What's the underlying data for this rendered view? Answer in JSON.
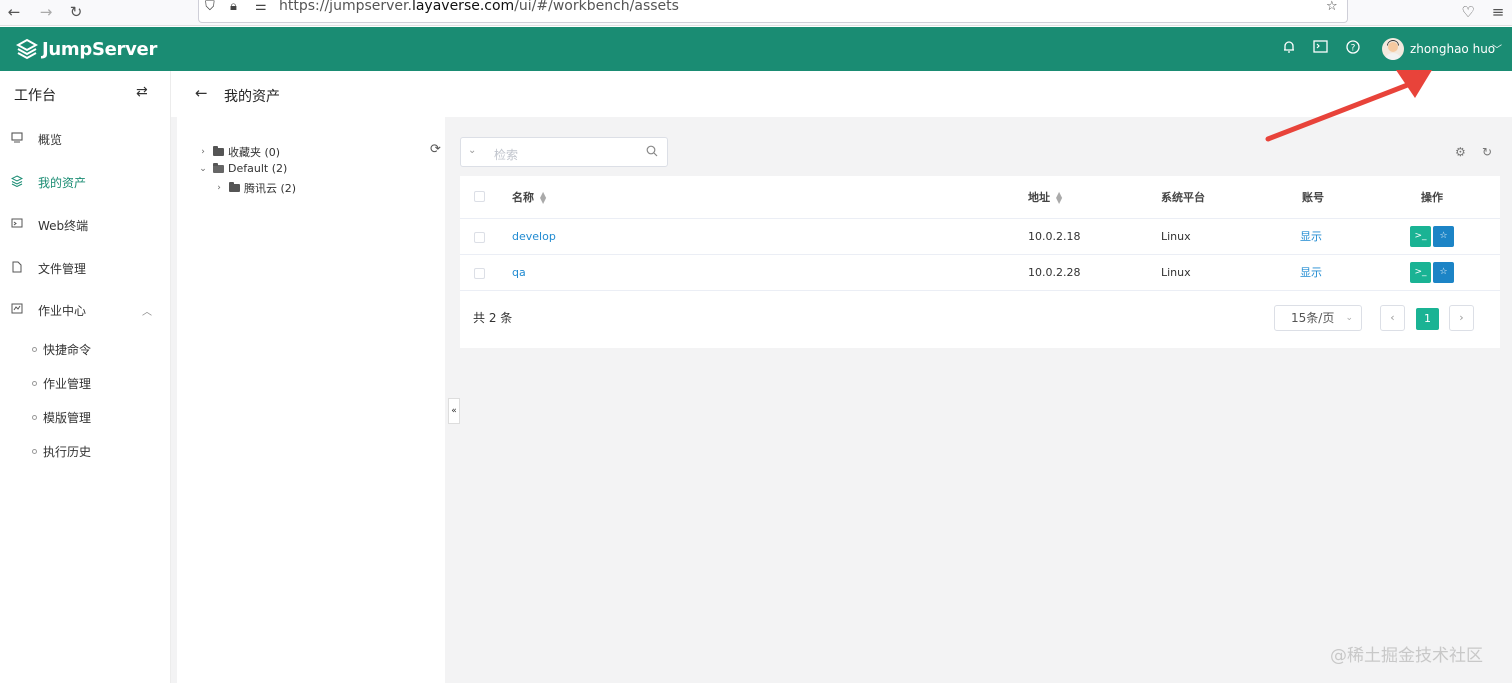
{
  "browser": {
    "url_prefix": "https://jumpserver.",
    "url_domain": "layaverse.com",
    "url_path": "/ui/#/workbench/assets"
  },
  "header": {
    "logo_text": "JumpServer",
    "user_name": "zhonghao huo",
    "brand_color": "#1a8c73"
  },
  "sidebar": {
    "title": "工作台",
    "items": [
      {
        "label": "概览",
        "icon": "monitor-icon"
      },
      {
        "label": "我的资产",
        "icon": "layers-icon",
        "active": true
      },
      {
        "label": "Web终端",
        "icon": "terminal-icon"
      },
      {
        "label": "文件管理",
        "icon": "file-icon"
      },
      {
        "label": "作业中心",
        "icon": "job-icon"
      }
    ],
    "sub_items": [
      "快捷命令",
      "作业管理",
      "模版管理",
      "执行历史"
    ]
  },
  "page": {
    "title": "我的资产"
  },
  "tree": {
    "nodes": [
      {
        "label": "收藏夹 (0)"
      },
      {
        "label": "Default (2)"
      },
      {
        "label": "腾讯云 (2)"
      }
    ]
  },
  "search": {
    "placeholder": "检索"
  },
  "table": {
    "columns": [
      "名称",
      "地址",
      "系统平台",
      "账号",
      "操作"
    ],
    "rows": [
      {
        "name": "develop",
        "address": "10.0.2.18",
        "platform": "Linux",
        "account": "显示"
      },
      {
        "name": "qa",
        "address": "10.0.2.28",
        "platform": "Linux",
        "account": "显示"
      }
    ],
    "total": "共 2 条",
    "page_size": "15条/页",
    "current_page": "1"
  },
  "watermark": "@稀土掘金技术社区"
}
